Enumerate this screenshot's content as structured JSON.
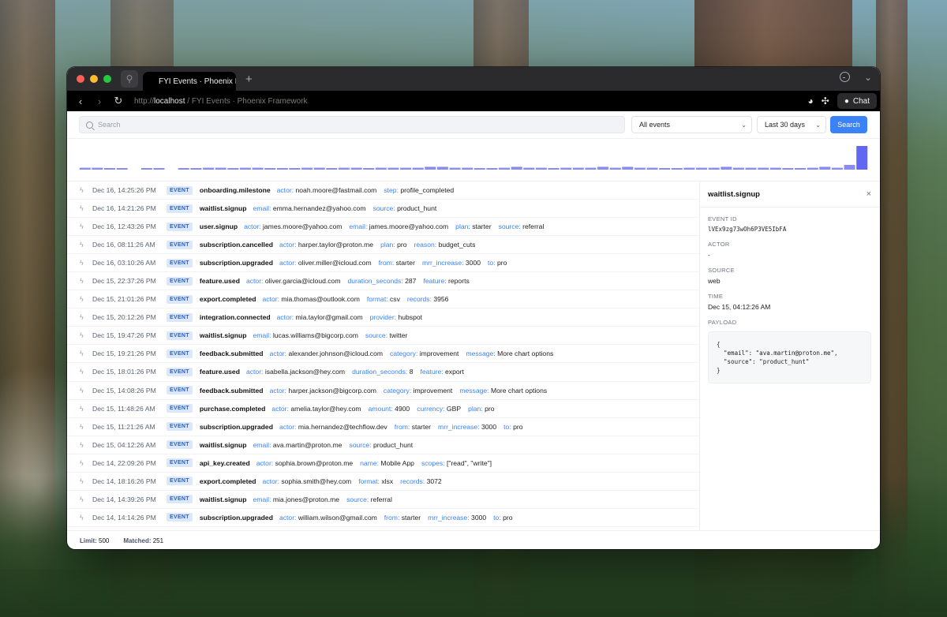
{
  "browser": {
    "tab_title": "FYI Events · Phoenix Fr",
    "new_tab": "+",
    "url_scheme": "http://",
    "url_host": "localhost",
    "url_rest": " / FYI Events · Phoenix Framework",
    "chat_label": "Chat"
  },
  "toolbar": {
    "search_placeholder": "Search",
    "event_filter": "All events",
    "range_filter": "Last 30 days",
    "search_button": "Search"
  },
  "histogram": {
    "accent": "#6366f1",
    "counts": [
      2,
      2,
      1,
      1,
      0,
      1,
      1,
      0,
      1,
      1,
      2,
      2,
      1,
      2,
      2,
      1,
      1,
      1,
      2,
      2,
      1,
      2,
      2,
      1,
      2,
      2,
      2,
      2,
      3,
      3,
      2,
      2,
      1,
      1,
      2,
      3,
      2,
      2,
      1,
      2,
      2,
      2,
      3,
      2,
      3,
      2,
      2,
      1,
      1,
      2,
      2,
      2,
      3,
      2,
      2,
      2,
      2,
      1,
      1,
      2,
      3,
      2,
      5,
      25
    ]
  },
  "events": [
    {
      "time": "Dec 16, 14:25:26 PM",
      "badge": "EVENT",
      "name": "onboarding.milestone",
      "props": [
        [
          "actor:",
          "noah.moore@fastmail.com"
        ],
        [
          "step:",
          "profile_completed"
        ]
      ]
    },
    {
      "time": "Dec 16, 14:21:26 PM",
      "badge": "EVENT",
      "name": "waitlist.signup",
      "props": [
        [
          "email:",
          "emma.hernandez@yahoo.com"
        ],
        [
          "source:",
          "product_hunt"
        ]
      ]
    },
    {
      "time": "Dec 16, 12:43:26 PM",
      "badge": "EVENT",
      "name": "user.signup",
      "props": [
        [
          "actor:",
          "james.moore@yahoo.com"
        ],
        [
          "email:",
          "james.moore@yahoo.com"
        ],
        [
          "plan:",
          "starter"
        ],
        [
          "source:",
          "referral"
        ]
      ]
    },
    {
      "time": "Dec 16, 08:11:26 AM",
      "badge": "EVENT",
      "name": "subscription.cancelled",
      "props": [
        [
          "actor:",
          "harper.taylor@proton.me"
        ],
        [
          "plan:",
          "pro"
        ],
        [
          "reason:",
          "budget_cuts"
        ]
      ]
    },
    {
      "time": "Dec 16, 03:10:26 AM",
      "badge": "EVENT",
      "name": "subscription.upgraded",
      "props": [
        [
          "actor:",
          "oliver.miller@icloud.com"
        ],
        [
          "from:",
          "starter"
        ],
        [
          "mrr_increase:",
          "3000"
        ],
        [
          "to:",
          "pro"
        ]
      ]
    },
    {
      "time": "Dec 15, 22:37:26 PM",
      "badge": "EVENT",
      "name": "feature.used",
      "props": [
        [
          "actor:",
          "oliver.garcia@icloud.com"
        ],
        [
          "duration_seconds:",
          "287"
        ],
        [
          "feature:",
          "reports"
        ]
      ]
    },
    {
      "time": "Dec 15, 21:01:26 PM",
      "badge": "EVENT",
      "name": "export.completed",
      "props": [
        [
          "actor:",
          "mia.thomas@outlook.com"
        ],
        [
          "format:",
          "csv"
        ],
        [
          "records:",
          "3956"
        ]
      ]
    },
    {
      "time": "Dec 15, 20:12:26 PM",
      "badge": "EVENT",
      "name": "integration.connected",
      "props": [
        [
          "actor:",
          "mia.taylor@gmail.com"
        ],
        [
          "provider:",
          "hubspot"
        ]
      ]
    },
    {
      "time": "Dec 15, 19:47:26 PM",
      "badge": "EVENT",
      "name": "waitlist.signup",
      "props": [
        [
          "email:",
          "lucas.williams@bigcorp.com"
        ],
        [
          "source:",
          "twitter"
        ]
      ]
    },
    {
      "time": "Dec 15, 19:21:26 PM",
      "badge": "EVENT",
      "name": "feedback.submitted",
      "props": [
        [
          "actor:",
          "alexander.johnson@icloud.com"
        ],
        [
          "category:",
          "improvement"
        ],
        [
          "message:",
          "More chart options"
        ]
      ]
    },
    {
      "time": "Dec 15, 18:01:26 PM",
      "badge": "EVENT",
      "name": "feature.used",
      "props": [
        [
          "actor:",
          "isabella.jackson@hey.com"
        ],
        [
          "duration_seconds:",
          "8"
        ],
        [
          "feature:",
          "export"
        ]
      ]
    },
    {
      "time": "Dec 15, 14:08:26 PM",
      "badge": "EVENT",
      "name": "feedback.submitted",
      "props": [
        [
          "actor:",
          "harper.jackson@bigcorp.com"
        ],
        [
          "category:",
          "improvement"
        ],
        [
          "message:",
          "More chart options"
        ]
      ]
    },
    {
      "time": "Dec 15, 11:48:26 AM",
      "badge": "EVENT",
      "name": "purchase.completed",
      "props": [
        [
          "actor:",
          "amelia.taylor@hey.com"
        ],
        [
          "amount:",
          "4900"
        ],
        [
          "currency:",
          "GBP"
        ],
        [
          "plan:",
          "pro"
        ]
      ]
    },
    {
      "time": "Dec 15, 11:21:26 AM",
      "badge": "EVENT",
      "name": "subscription.upgraded",
      "props": [
        [
          "actor:",
          "mia.hernandez@techflow.dev"
        ],
        [
          "from:",
          "starter"
        ],
        [
          "mrr_increase:",
          "3000"
        ],
        [
          "to:",
          "pro"
        ]
      ]
    },
    {
      "time": "Dec 15, 04:12:26 AM",
      "badge": "EVENT",
      "name": "waitlist.signup",
      "props": [
        [
          "email:",
          "ava.martin@proton.me"
        ],
        [
          "source:",
          "product_hunt"
        ]
      ]
    },
    {
      "time": "Dec 14, 22:09:26 PM",
      "badge": "EVENT",
      "name": "api_key.created",
      "props": [
        [
          "actor:",
          "sophia.brown@proton.me"
        ],
        [
          "name:",
          "Mobile App"
        ],
        [
          "scopes:",
          "[\"read\", \"write\"]"
        ]
      ]
    },
    {
      "time": "Dec 14, 18:16:26 PM",
      "badge": "EVENT",
      "name": "export.completed",
      "props": [
        [
          "actor:",
          "sophia.smith@hey.com"
        ],
        [
          "format:",
          "xlsx"
        ],
        [
          "records:",
          "3072"
        ]
      ]
    },
    {
      "time": "Dec 14, 14:39:26 PM",
      "badge": "EVENT",
      "name": "waitlist.signup",
      "props": [
        [
          "email:",
          "mia.jones@proton.me"
        ],
        [
          "source:",
          "referral"
        ]
      ]
    },
    {
      "time": "Dec 14, 14:14:26 PM",
      "badge": "EVENT",
      "name": "subscription.upgraded",
      "props": [
        [
          "actor:",
          "william.wilson@gmail.com"
        ],
        [
          "from:",
          "starter"
        ],
        [
          "mrr_increase:",
          "3000"
        ],
        [
          "to:",
          "pro"
        ]
      ]
    }
  ],
  "detail": {
    "title": "waitlist.signup",
    "close": "×",
    "event_id_label": "EVENT ID",
    "event_id": "lVEx9zg73wOh6P3VE5IbFA",
    "actor_label": "ACTOR",
    "actor": "-",
    "source_label": "SOURCE",
    "source": "web",
    "time_label": "TIME",
    "time": "Dec 15, 04:12:26 AM",
    "payload_label": "PAYLOAD",
    "payload": "{\n  \"email\": \"ava.martin@proton.me\",\n  \"source\": \"product_hunt\"\n}"
  },
  "footer": {
    "limit_label": "Limit:",
    "limit": "500",
    "matched_label": "Matched:",
    "matched": "251"
  }
}
